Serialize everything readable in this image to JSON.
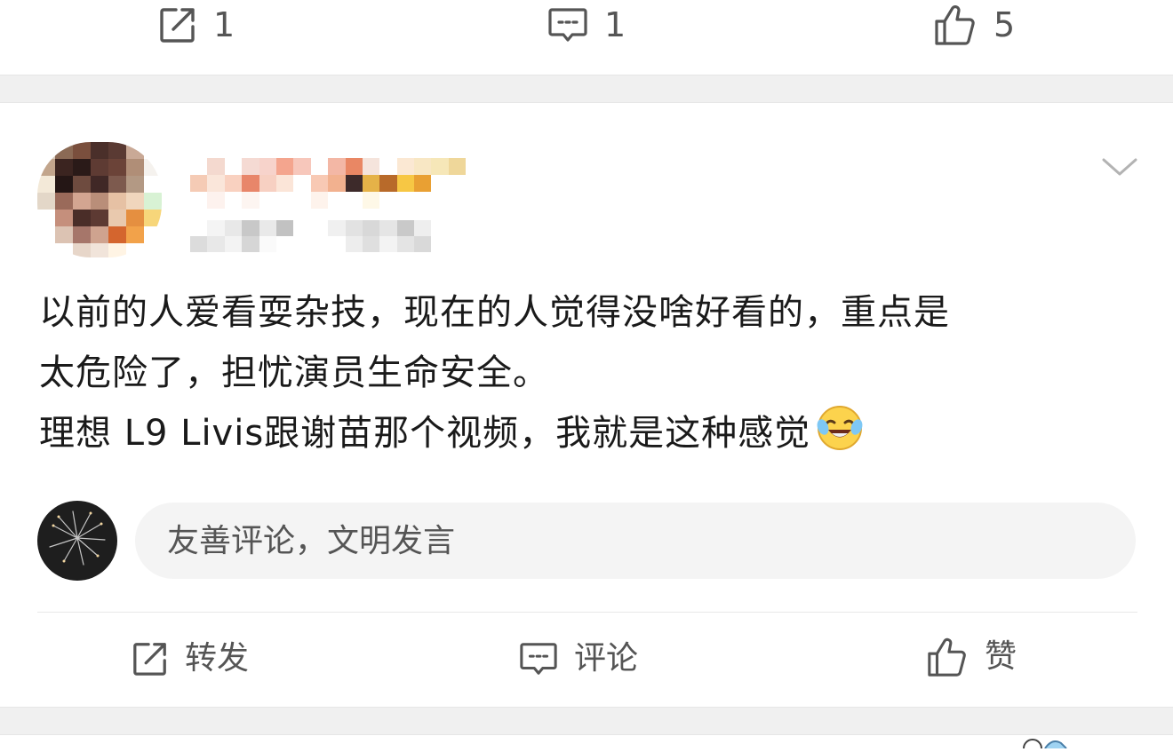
{
  "top_actions": {
    "repost_count": "1",
    "comment_count": "1",
    "like_count": "5"
  },
  "post": {
    "lines": [
      "以前的人爱看耍杂技，现在的人觉得没啥好看的，重点是",
      "太危险了，担忧演员生命安全。",
      "理想 L9 Livis跟谢苗那个视频，我就是这种感觉"
    ],
    "emoji": "laugh-cry-emoji"
  },
  "comment_box": {
    "placeholder": "友善评论，文明发言"
  },
  "bottom_actions": {
    "repost_label": "转发",
    "comment_label": "评论",
    "like_label": "赞"
  },
  "icons": {
    "repost": "share-square-icon",
    "comment": "comment-bubble-icon",
    "like": "thumbs-up-icon",
    "more": "chevron-down-icon"
  },
  "colors": {
    "icon_gray": "#555555",
    "separator_gray": "#f0f0f0",
    "input_bg": "#f4f4f4",
    "text": "#1a1a1a"
  }
}
